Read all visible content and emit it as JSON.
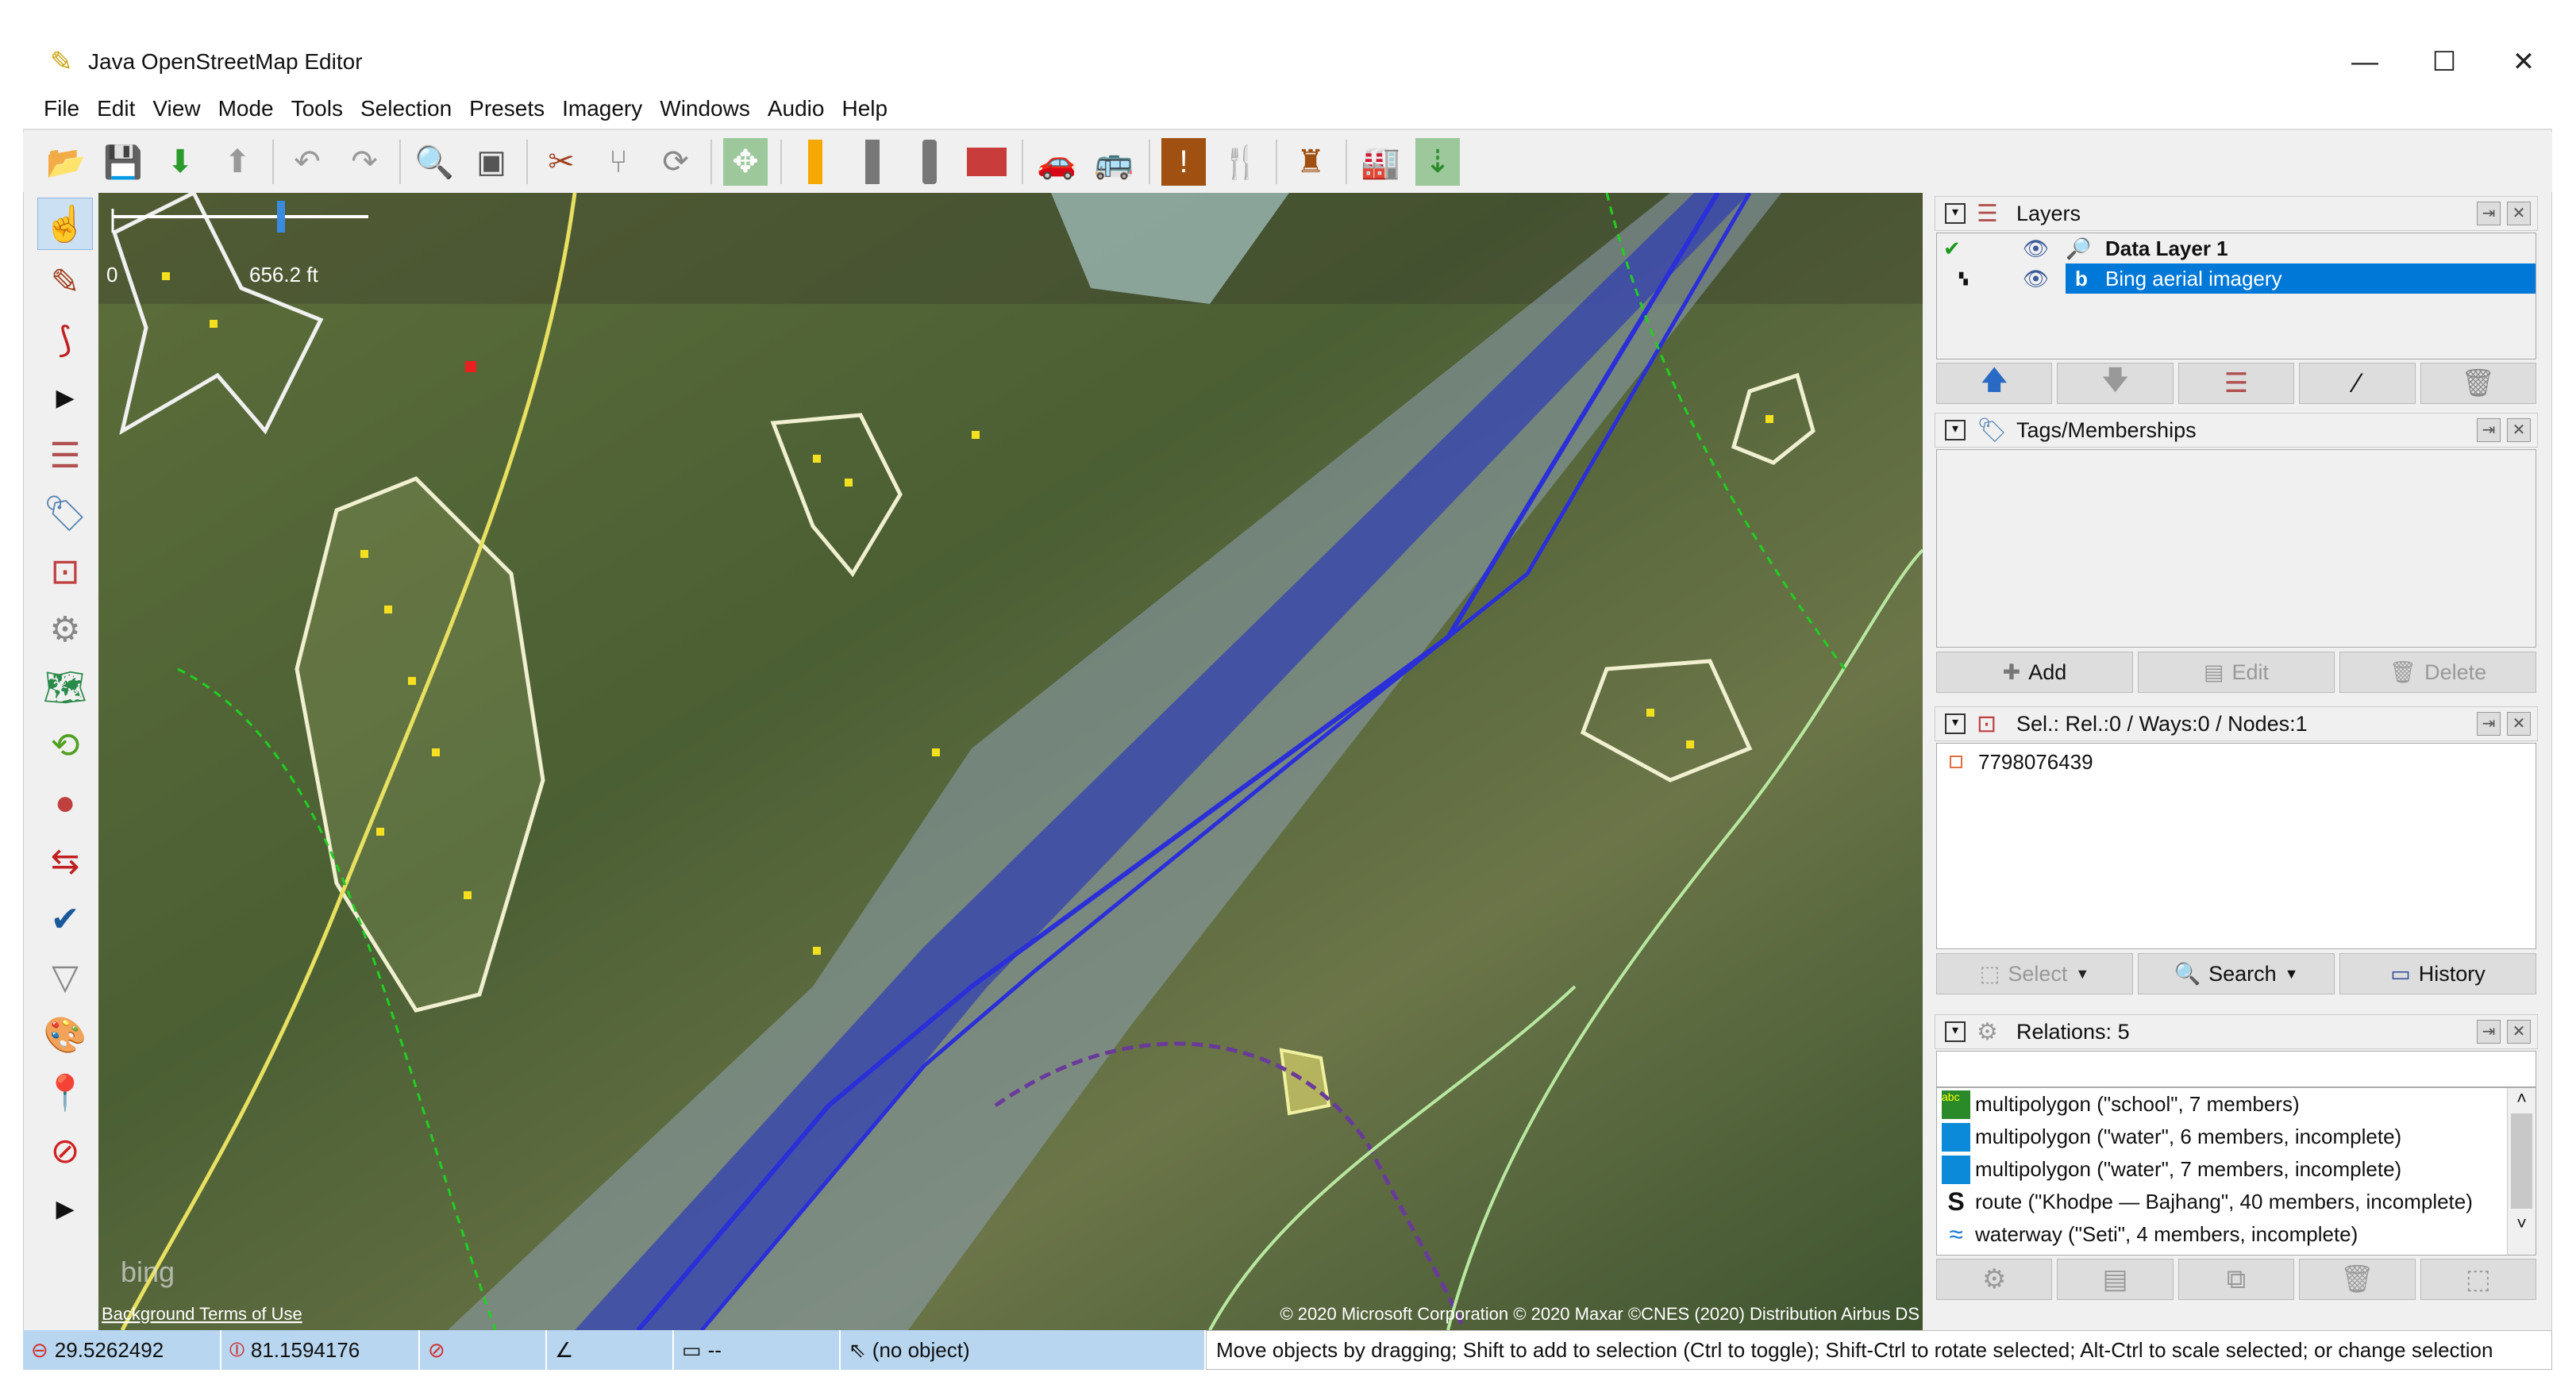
{
  "window": {
    "title": "Java OpenStreetMap Editor",
    "minimize": "—",
    "maximize": "☐",
    "close": "✕"
  },
  "menu": [
    "File",
    "Edit",
    "View",
    "Mode",
    "Tools",
    "Selection",
    "Presets",
    "Imagery",
    "Windows",
    "Audio",
    "Help"
  ],
  "toolbar_icons": [
    "open-file",
    "save",
    "download",
    "upload",
    "undo",
    "redo",
    "zoom",
    "preferences",
    "split-way",
    "combine",
    "refresh",
    "imagery-offset",
    "highway-yellow",
    "road-grey",
    "roundabout",
    "wall",
    "car",
    "bus",
    "amenity",
    "restaurant",
    "castle",
    "industrial",
    "download-area"
  ],
  "map": {
    "scale_zero": "0",
    "scale_label": "656.2 ft",
    "bing_logo": "bing",
    "terms": "Background Terms of Use",
    "attribution": "© 2020 Microsoft Corporation © 2020 Maxar ©CNES (2020) Distribution Airbus DS"
  },
  "layers": {
    "title": "Layers",
    "items": [
      {
        "name": "Data Layer 1",
        "active": true
      },
      {
        "name": "Bing aerial imagery",
        "selected": true
      }
    ]
  },
  "tags": {
    "title": "Tags/Memberships",
    "add": "Add",
    "edit": "Edit",
    "delete": "Delete"
  },
  "selection": {
    "title": "Sel.: Rel.:0 / Ways:0 / Nodes:1",
    "items": [
      "7798076439"
    ],
    "select": "Select",
    "search": "Search",
    "history": "History"
  },
  "relations": {
    "title": "Relations: 5",
    "filter": "",
    "items": [
      "multipolygon (\"school\", 7 members)",
      "multipolygon (\"water\", 6 members, incomplete)",
      "multipolygon (\"water\", 7 members, incomplete)",
      "route (\"Khodpe — Bajhang\", 40 members, incomplete)",
      "waterway (\"Seti\", 4 members, incomplete)"
    ]
  },
  "status": {
    "lat": "29.5262492",
    "lon": "81.1594176",
    "heading": "",
    "angle": "",
    "distance": "--",
    "object": "(no object)",
    "message": "Move objects by dragging; Shift to add to selection (Ctrl to toggle); Shift-Ctrl to rotate selected; Alt-Ctrl to scale selected; or change selection"
  },
  "colors": {
    "selection": "#0078d7",
    "status_bg": "#b8d6f0",
    "river": "#2a2fd8",
    "area": "#e8f0a0"
  }
}
